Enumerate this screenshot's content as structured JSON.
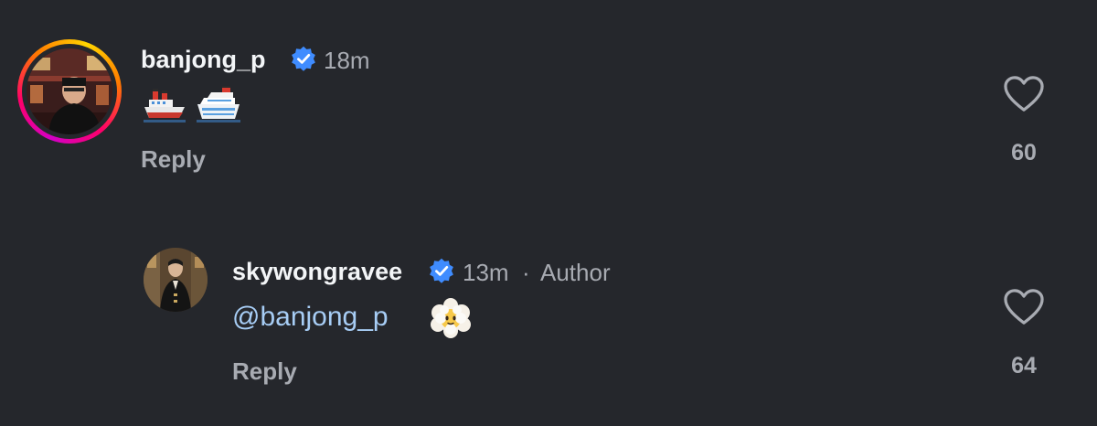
{
  "comments": [
    {
      "username": "banjong_p",
      "time": "18m",
      "emojis": [
        "cargo-ship-emoji",
        "cruise-ship-emoji"
      ],
      "reply_label": "Reply",
      "like_count": "60"
    },
    {
      "username": "skywongravee",
      "time": "13m",
      "separator": "·",
      "author_label": "Author",
      "mention": "@banjong_p",
      "emojis": [
        "face-in-clouds-emoji"
      ],
      "reply_label": "Reply",
      "like_count": "64"
    }
  ],
  "colors": {
    "background": "#25272c",
    "text": "#f3f5f7",
    "secondary": "#a8abb2",
    "mention": "#a7cdf5",
    "verified": "#3f8cff"
  }
}
